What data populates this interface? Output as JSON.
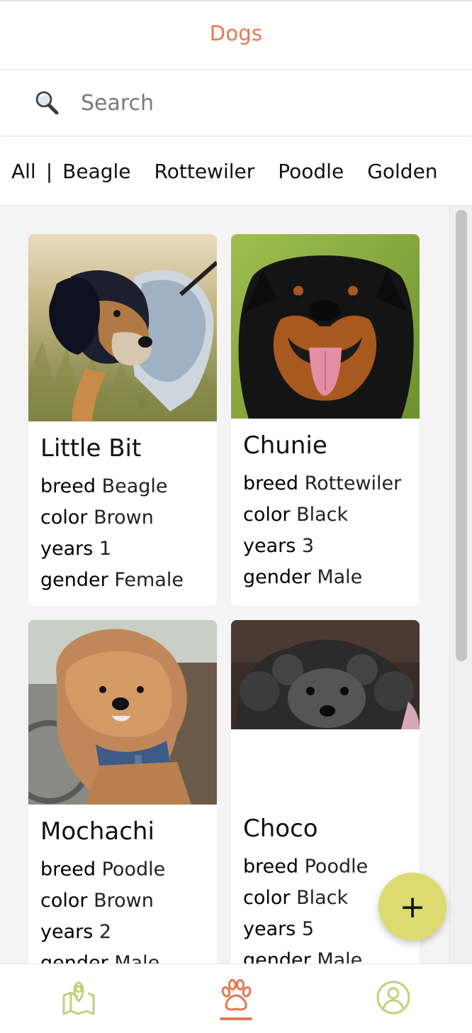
{
  "header": {
    "title": "Dogs"
  },
  "search": {
    "placeholder": "Search",
    "icon": "search-icon"
  },
  "filters": {
    "tabs": [
      {
        "label": "All",
        "active": true
      },
      {
        "label": "Beagle"
      },
      {
        "label": "Rottewiler"
      },
      {
        "label": "Poodle"
      },
      {
        "label": "Golden"
      }
    ],
    "separator": "|"
  },
  "labels": {
    "breed": "breed",
    "color": "color",
    "years": "years",
    "gender": "gender"
  },
  "dogs": [
    {
      "name": "Little Bit",
      "breed": "Beagle",
      "color": "Brown",
      "years": "1",
      "gender": "Female"
    },
    {
      "name": "Chunie",
      "breed": "Rottewiler",
      "color": "Black",
      "years": "3",
      "gender": "Male"
    },
    {
      "name": "Mochachi",
      "breed": "Poodle",
      "color": "Brown",
      "years": "2",
      "gender": "Male"
    },
    {
      "name": "Choco",
      "breed": "Poodle",
      "color": "Black",
      "years": "5",
      "gender": "Male"
    }
  ],
  "fab": {
    "label": "+"
  },
  "nav": {
    "items": [
      {
        "icon": "map-pin-icon",
        "active": false
      },
      {
        "icon": "paw-icon",
        "active": true
      },
      {
        "icon": "user-circle-icon",
        "active": false
      }
    ]
  },
  "colors": {
    "accent": "#e8774e",
    "fab": "#dcdb72",
    "nav_icon": "#c2d07a"
  }
}
